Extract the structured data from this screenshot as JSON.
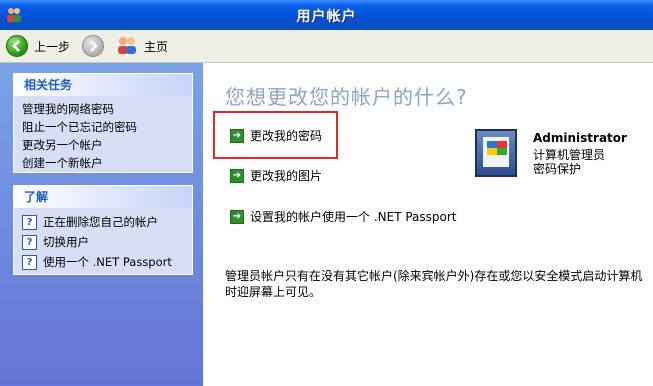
{
  "window": {
    "title": "用户帐户",
    "icon": "users-icon"
  },
  "toolbar": {
    "back_label": "上一步",
    "home_label": "主页"
  },
  "left": {
    "tasks_header": "相关任务",
    "tasks": [
      "管理我的网络密码",
      "阻止一个已忘记的密码",
      "更改另一个帐户",
      "创建一个新帐户"
    ],
    "learn_header": "了解",
    "learn": [
      "正在删除您自己的帐户",
      "切换用户",
      "使用一个 .NET Passport"
    ]
  },
  "main": {
    "heading": "您想更改您的帐户的什么?",
    "tasks": [
      "更改我的密码",
      "更改我的图片",
      "设置我的帐户使用一个 .NET Passport"
    ],
    "account": {
      "name": "Administrator",
      "role": "计算机管理员",
      "status": "密码保护"
    },
    "note": "管理员帐户只有在没有其它帐户(除来宾帐户外)存在或您以安全模式启动计算机时迎屏幕上可见。"
  },
  "colors": {
    "titlebar": "#0752d8",
    "left_panel": "#7ba2e7",
    "highlight_box": "#e02a2a",
    "task_arrow": "#2f8f2f",
    "heading": "#8fa3c9"
  }
}
